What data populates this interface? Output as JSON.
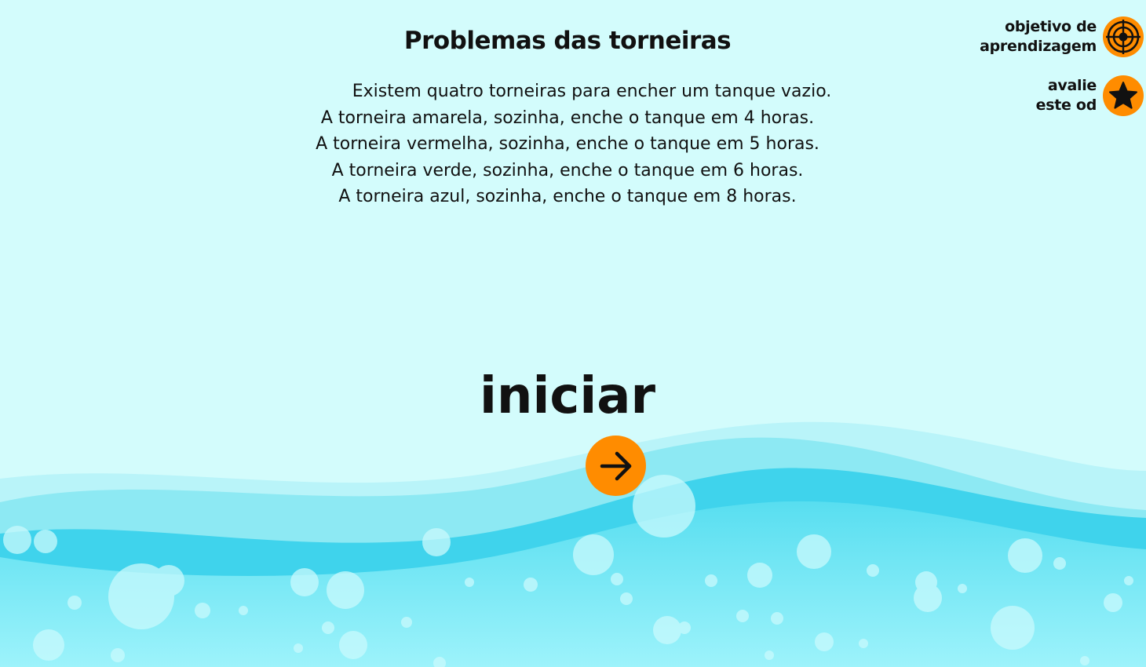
{
  "title": "Problemas das torneiras",
  "description": [
    "Existem quatro torneiras para encher um tanque vazio.",
    "A torneira amarela, sozinha, enche o tanque em 4 horas.",
    "A torneira vermelha, sozinha, enche o tanque em 5 horas.",
    "A torneira verde, sozinha, enche o tanque em 6 horas.",
    "A torneira azul, sozinha, enche o tanque em 8 horas."
  ],
  "side_menu": {
    "objective": {
      "line1": "objetivo de",
      "line2": "aprendizagem",
      "icon": "target-icon"
    },
    "rate": {
      "line1": "avalie",
      "line2": "este od",
      "icon": "star-icon"
    }
  },
  "start": {
    "label": "iniciar",
    "icon": "arrow-right-icon"
  },
  "colors": {
    "background": "#d3fcfc",
    "accent": "#ff8c00",
    "water_light": "#9eeef5",
    "water_mid": "#4fd8ee",
    "water_deep": "#33cdea"
  }
}
